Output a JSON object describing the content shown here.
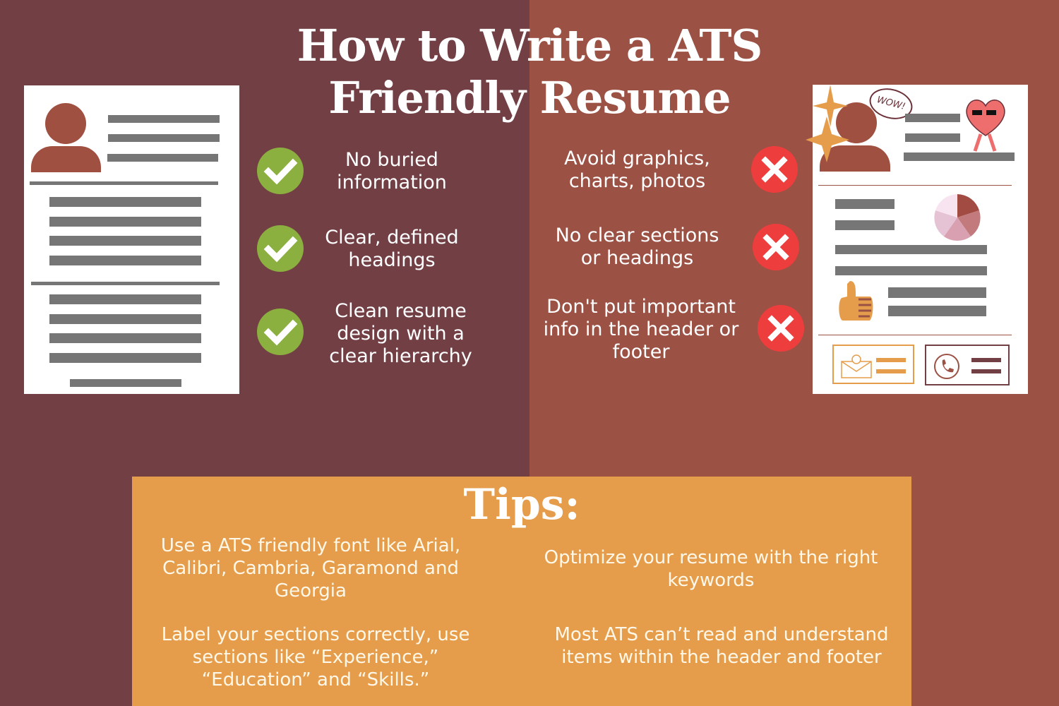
{
  "title": {
    "line1": "How to Write a ATS",
    "line2": "Friendly Resume"
  },
  "colors": {
    "left_bg": "#723f45",
    "right_bg": "#9c5145",
    "tips_bg": "#e59d4c",
    "check": "#8cb040",
    "cross": "#ee3d3d",
    "placeholder_bar": "#767676",
    "avatar": "#a05040"
  },
  "dos": [
    {
      "icon": "check-icon",
      "text": "No buried information"
    },
    {
      "icon": "check-icon",
      "text": "Clear, defined headings"
    },
    {
      "icon": "check-icon",
      "text": "Clean resume design with a clear hierarchy"
    }
  ],
  "donts": [
    {
      "icon": "cross-icon",
      "text": "Avoid graphics, charts, photos"
    },
    {
      "icon": "cross-icon",
      "text": "No clear sections or headings"
    },
    {
      "icon": "cross-icon",
      "text": "Don't put important info in the header or footer"
    }
  ],
  "bad_resume": {
    "speech_bubble": "WOW!"
  },
  "tips": {
    "heading": "Tips:",
    "items": [
      "Use a ATS friendly font like Arial, Calibri, Cambria, Garamond and Georgia",
      "Optimize your resume with the right keywords",
      "Label your sections correctly, use sections like “Experience,” “Education” and “Skills.”",
      "Most ATS can’t read and understand items within the header and footer"
    ]
  }
}
